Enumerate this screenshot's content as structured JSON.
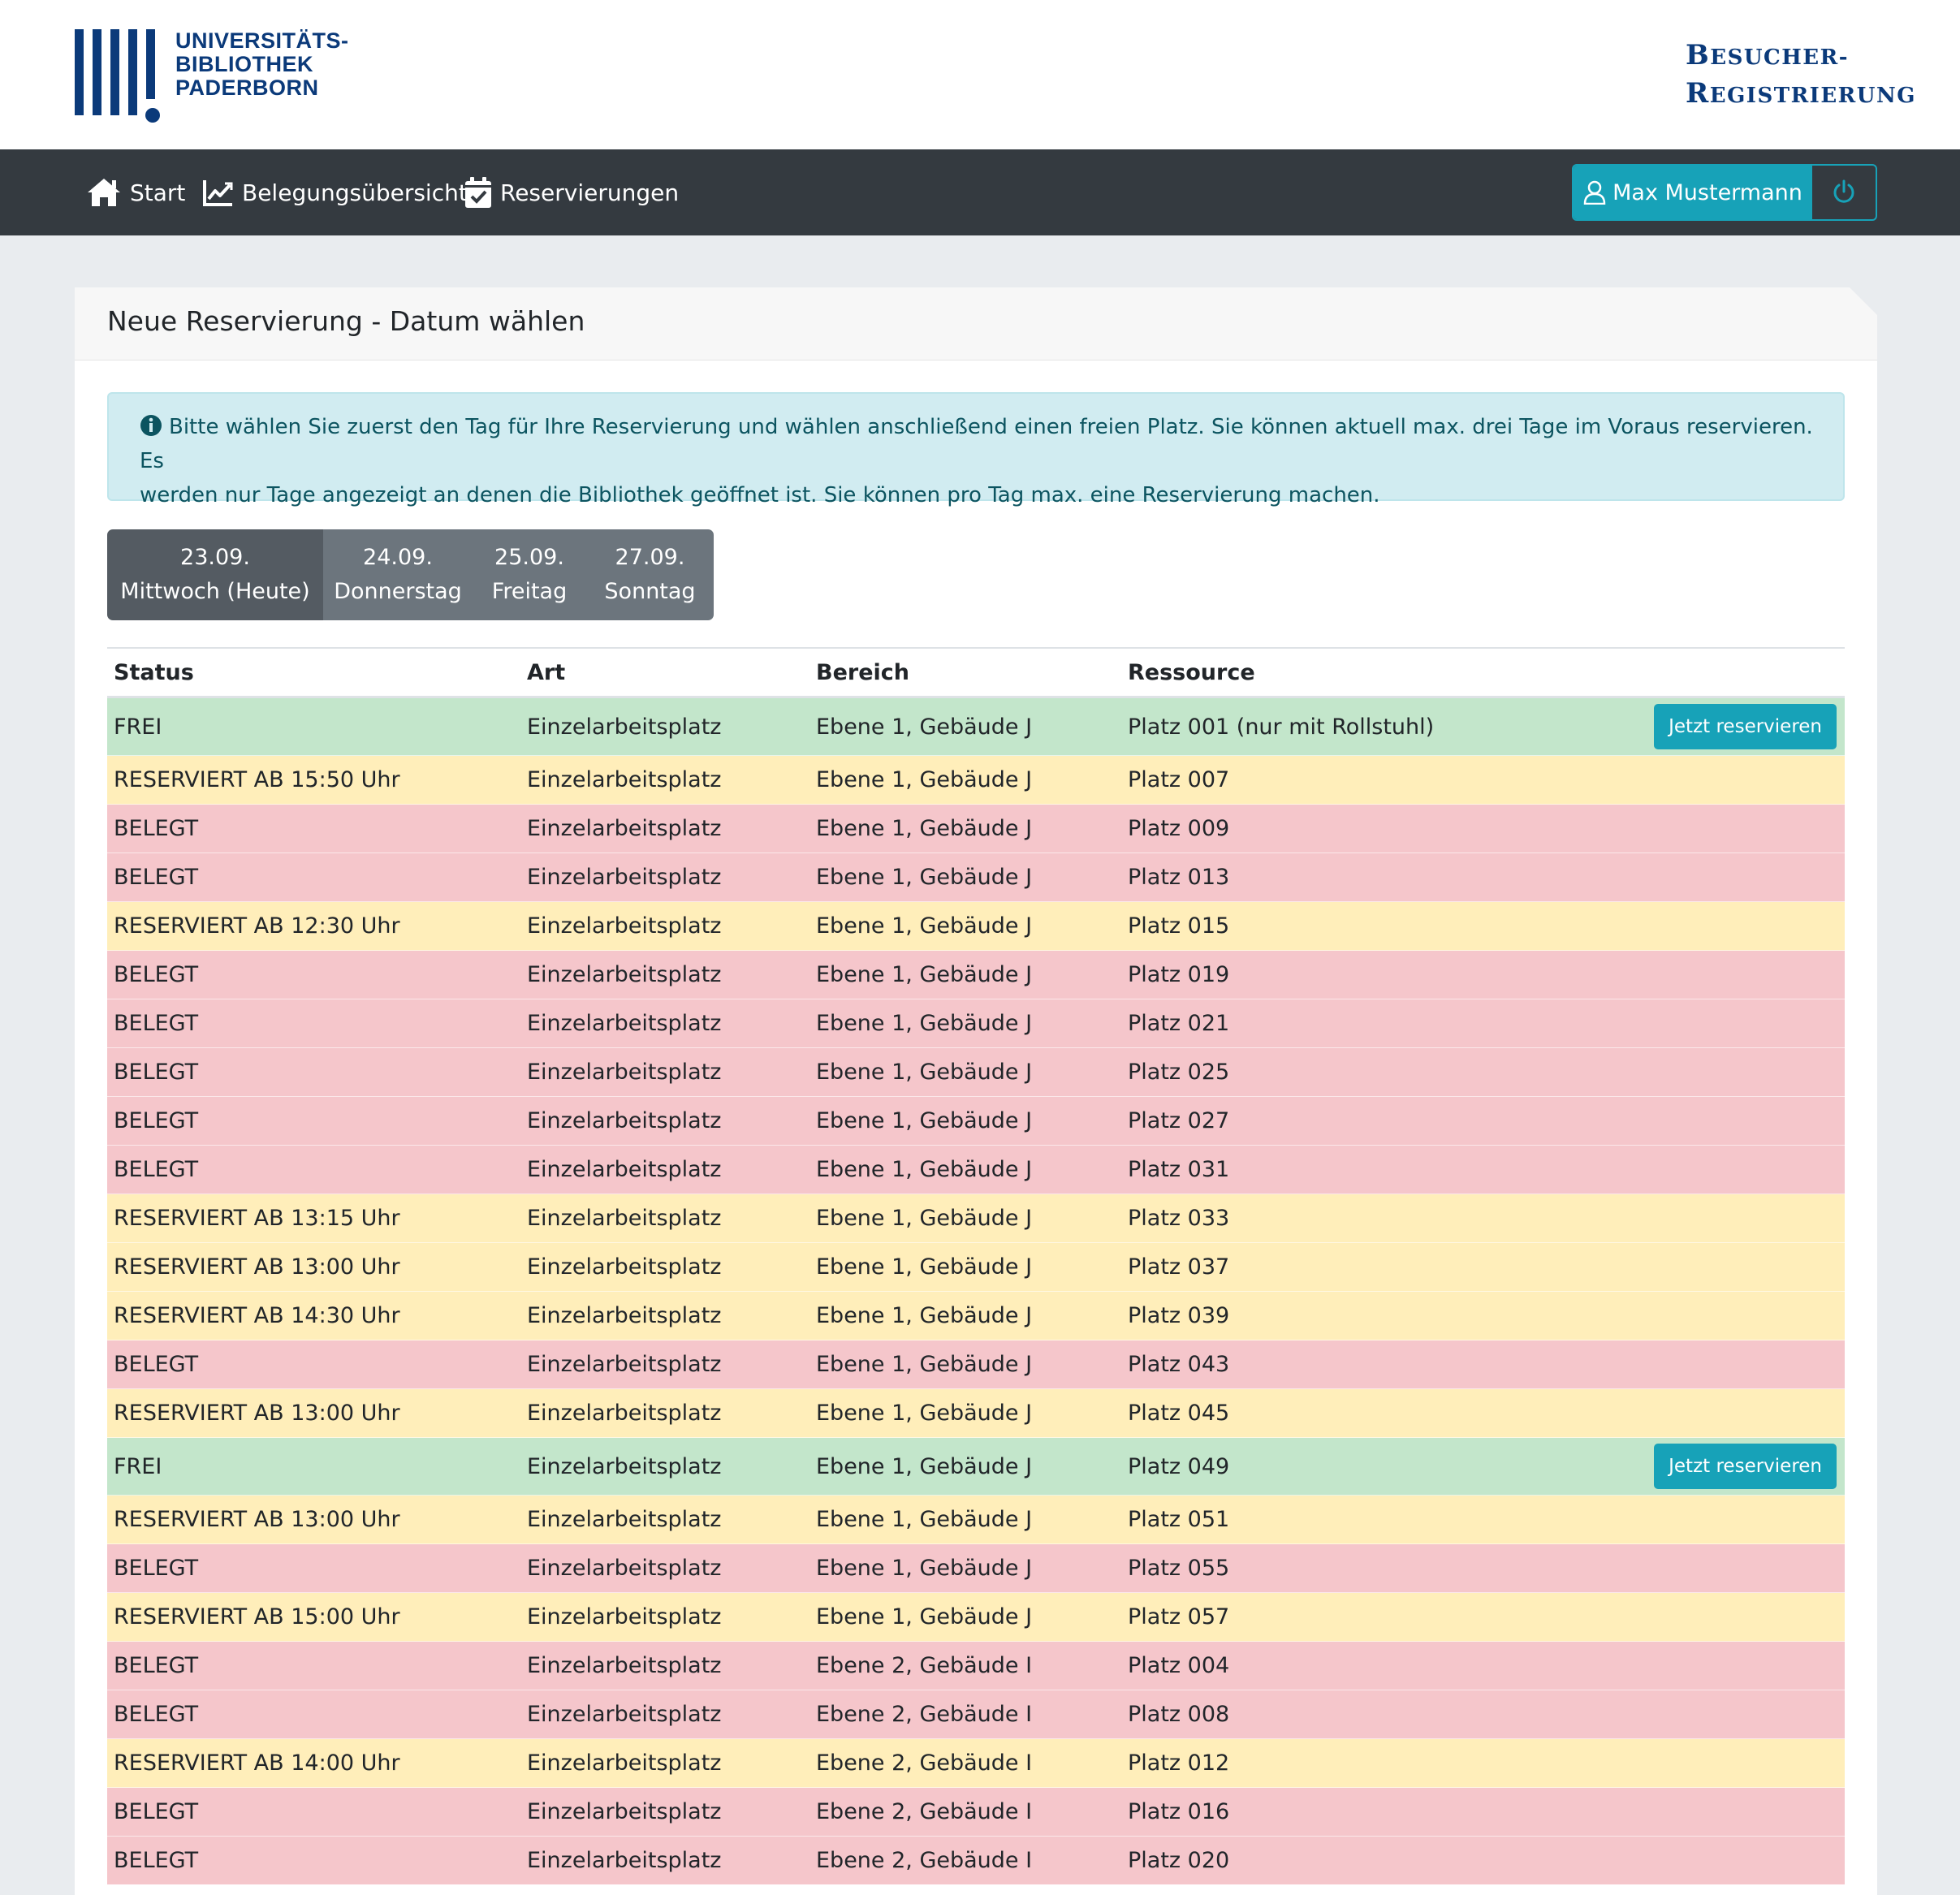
{
  "logo": {
    "line1": "UNIVERSITÄTS-",
    "line2": "BIBLIOTHEK",
    "line3": "PADERBORN",
    "color": "#0b3a7a"
  },
  "site_title": {
    "line1_initial": "B",
    "line1_rest": "ESUCHER-",
    "line2_initial": "R",
    "line2_rest": "EGISTRIERUNG"
  },
  "nav": {
    "items": [
      {
        "label": "Start",
        "icon": "home-icon"
      },
      {
        "label": "Belegungsübersicht",
        "icon": "chart-line-icon"
      },
      {
        "label": "Reservierungen",
        "icon": "calendar-check-icon"
      }
    ],
    "user_label": "Max Mustermann",
    "user_icon": "user-icon",
    "logout_icon": "power-icon"
  },
  "card": {
    "title": "Neue Reservierung - Datum wählen",
    "info_line1": "Bitte wählen Sie zuerst den Tag für Ihre Reservierung und wählen anschließend einen freien Platz. Sie können aktuell max. drei Tage im Voraus reservieren. Es",
    "info_line2": "werden nur Tage angezeigt an denen die Bibliothek geöffnet ist. Sie können pro Tag max. eine Reservierung machen."
  },
  "dates": [
    {
      "date": "23.09.",
      "day": "Mittwoch (Heute)",
      "active": true
    },
    {
      "date": "24.09.",
      "day": "Donnerstag",
      "active": false
    },
    {
      "date": "25.09.",
      "day": "Freitag",
      "active": false
    },
    {
      "date": "27.09.",
      "day": "Sonntag",
      "active": false
    }
  ],
  "table": {
    "headers": {
      "status": "Status",
      "art": "Art",
      "bereich": "Bereich",
      "ressource": "Ressource"
    },
    "reserve_label": "Jetzt reservieren",
    "rows": [
      {
        "status": "FREI",
        "art": "Einzelarbeitsplatz",
        "bereich": "Ebene 1, Gebäude J",
        "ressource": "Platz 001 (nur mit Rollstuhl)",
        "kind": "frei"
      },
      {
        "status": "RESERVIERT AB 15:50 Uhr",
        "art": "Einzelarbeitsplatz",
        "bereich": "Ebene 1, Gebäude J",
        "ressource": "Platz 007",
        "kind": "res"
      },
      {
        "status": "BELEGT",
        "art": "Einzelarbeitsplatz",
        "bereich": "Ebene 1, Gebäude J",
        "ressource": "Platz 009",
        "kind": "bel"
      },
      {
        "status": "BELEGT",
        "art": "Einzelarbeitsplatz",
        "bereich": "Ebene 1, Gebäude J",
        "ressource": "Platz 013",
        "kind": "bel"
      },
      {
        "status": "RESERVIERT AB 12:30 Uhr",
        "art": "Einzelarbeitsplatz",
        "bereich": "Ebene 1, Gebäude J",
        "ressource": "Platz 015",
        "kind": "res"
      },
      {
        "status": "BELEGT",
        "art": "Einzelarbeitsplatz",
        "bereich": "Ebene 1, Gebäude J",
        "ressource": "Platz 019",
        "kind": "bel"
      },
      {
        "status": "BELEGT",
        "art": "Einzelarbeitsplatz",
        "bereich": "Ebene 1, Gebäude J",
        "ressource": "Platz 021",
        "kind": "bel"
      },
      {
        "status": "BELEGT",
        "art": "Einzelarbeitsplatz",
        "bereich": "Ebene 1, Gebäude J",
        "ressource": "Platz 025",
        "kind": "bel"
      },
      {
        "status": "BELEGT",
        "art": "Einzelarbeitsplatz",
        "bereich": "Ebene 1, Gebäude J",
        "ressource": "Platz 027",
        "kind": "bel"
      },
      {
        "status": "BELEGT",
        "art": "Einzelarbeitsplatz",
        "bereich": "Ebene 1, Gebäude J",
        "ressource": "Platz 031",
        "kind": "bel"
      },
      {
        "status": "RESERVIERT AB 13:15 Uhr",
        "art": "Einzelarbeitsplatz",
        "bereich": "Ebene 1, Gebäude J",
        "ressource": "Platz 033",
        "kind": "res"
      },
      {
        "status": "RESERVIERT AB 13:00 Uhr",
        "art": "Einzelarbeitsplatz",
        "bereich": "Ebene 1, Gebäude J",
        "ressource": "Platz 037",
        "kind": "res"
      },
      {
        "status": "RESERVIERT AB 14:30 Uhr",
        "art": "Einzelarbeitsplatz",
        "bereich": "Ebene 1, Gebäude J",
        "ressource": "Platz 039",
        "kind": "res"
      },
      {
        "status": "BELEGT",
        "art": "Einzelarbeitsplatz",
        "bereich": "Ebene 1, Gebäude J",
        "ressource": "Platz 043",
        "kind": "bel"
      },
      {
        "status": "RESERVIERT AB 13:00 Uhr",
        "art": "Einzelarbeitsplatz",
        "bereich": "Ebene 1, Gebäude J",
        "ressource": "Platz 045",
        "kind": "res"
      },
      {
        "status": "FREI",
        "art": "Einzelarbeitsplatz",
        "bereich": "Ebene 1, Gebäude J",
        "ressource": "Platz 049",
        "kind": "frei"
      },
      {
        "status": "RESERVIERT AB 13:00 Uhr",
        "art": "Einzelarbeitsplatz",
        "bereich": "Ebene 1, Gebäude J",
        "ressource": "Platz 051",
        "kind": "res"
      },
      {
        "status": "BELEGT",
        "art": "Einzelarbeitsplatz",
        "bereich": "Ebene 1, Gebäude J",
        "ressource": "Platz 055",
        "kind": "bel"
      },
      {
        "status": "RESERVIERT AB 15:00 Uhr",
        "art": "Einzelarbeitsplatz",
        "bereich": "Ebene 1, Gebäude J",
        "ressource": "Platz 057",
        "kind": "res"
      },
      {
        "status": "BELEGT",
        "art": "Einzelarbeitsplatz",
        "bereich": "Ebene 2, Gebäude I",
        "ressource": "Platz 004",
        "kind": "bel"
      },
      {
        "status": "BELEGT",
        "art": "Einzelarbeitsplatz",
        "bereich": "Ebene 2, Gebäude I",
        "ressource": "Platz 008",
        "kind": "bel"
      },
      {
        "status": "RESERVIERT AB 14:00 Uhr",
        "art": "Einzelarbeitsplatz",
        "bereich": "Ebene 2, Gebäude I",
        "ressource": "Platz 012",
        "kind": "res"
      },
      {
        "status": "BELEGT",
        "art": "Einzelarbeitsplatz",
        "bereich": "Ebene 2, Gebäude I",
        "ressource": "Platz 016",
        "kind": "bel"
      },
      {
        "status": "BELEGT",
        "art": "Einzelarbeitsplatz",
        "bereich": "Ebene 2, Gebäude I",
        "ressource": "Platz 020",
        "kind": "bel"
      }
    ]
  },
  "colors": {
    "navbar": "#343a40",
    "info": "#17a2b8",
    "frei": "#c3e6cb",
    "reserviert": "#ffeeba",
    "belegt": "#f5c6cb",
    "background": "#e9ecef"
  }
}
